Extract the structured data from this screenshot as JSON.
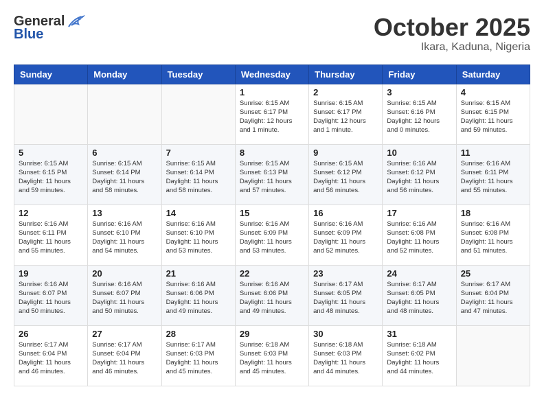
{
  "header": {
    "logo_general": "General",
    "logo_blue": "Blue",
    "month": "October 2025",
    "location": "Ikara, Kaduna, Nigeria"
  },
  "days_of_week": [
    "Sunday",
    "Monday",
    "Tuesday",
    "Wednesday",
    "Thursday",
    "Friday",
    "Saturday"
  ],
  "weeks": [
    [
      {
        "day": "",
        "info": ""
      },
      {
        "day": "",
        "info": ""
      },
      {
        "day": "",
        "info": ""
      },
      {
        "day": "1",
        "info": "Sunrise: 6:15 AM\nSunset: 6:17 PM\nDaylight: 12 hours\nand 1 minute."
      },
      {
        "day": "2",
        "info": "Sunrise: 6:15 AM\nSunset: 6:17 PM\nDaylight: 12 hours\nand 1 minute."
      },
      {
        "day": "3",
        "info": "Sunrise: 6:15 AM\nSunset: 6:16 PM\nDaylight: 12 hours\nand 0 minutes."
      },
      {
        "day": "4",
        "info": "Sunrise: 6:15 AM\nSunset: 6:15 PM\nDaylight: 11 hours\nand 59 minutes."
      }
    ],
    [
      {
        "day": "5",
        "info": "Sunrise: 6:15 AM\nSunset: 6:15 PM\nDaylight: 11 hours\nand 59 minutes."
      },
      {
        "day": "6",
        "info": "Sunrise: 6:15 AM\nSunset: 6:14 PM\nDaylight: 11 hours\nand 58 minutes."
      },
      {
        "day": "7",
        "info": "Sunrise: 6:15 AM\nSunset: 6:14 PM\nDaylight: 11 hours\nand 58 minutes."
      },
      {
        "day": "8",
        "info": "Sunrise: 6:15 AM\nSunset: 6:13 PM\nDaylight: 11 hours\nand 57 minutes."
      },
      {
        "day": "9",
        "info": "Sunrise: 6:15 AM\nSunset: 6:12 PM\nDaylight: 11 hours\nand 56 minutes."
      },
      {
        "day": "10",
        "info": "Sunrise: 6:16 AM\nSunset: 6:12 PM\nDaylight: 11 hours\nand 56 minutes."
      },
      {
        "day": "11",
        "info": "Sunrise: 6:16 AM\nSunset: 6:11 PM\nDaylight: 11 hours\nand 55 minutes."
      }
    ],
    [
      {
        "day": "12",
        "info": "Sunrise: 6:16 AM\nSunset: 6:11 PM\nDaylight: 11 hours\nand 55 minutes."
      },
      {
        "day": "13",
        "info": "Sunrise: 6:16 AM\nSunset: 6:10 PM\nDaylight: 11 hours\nand 54 minutes."
      },
      {
        "day": "14",
        "info": "Sunrise: 6:16 AM\nSunset: 6:10 PM\nDaylight: 11 hours\nand 53 minutes."
      },
      {
        "day": "15",
        "info": "Sunrise: 6:16 AM\nSunset: 6:09 PM\nDaylight: 11 hours\nand 53 minutes."
      },
      {
        "day": "16",
        "info": "Sunrise: 6:16 AM\nSunset: 6:09 PM\nDaylight: 11 hours\nand 52 minutes."
      },
      {
        "day": "17",
        "info": "Sunrise: 6:16 AM\nSunset: 6:08 PM\nDaylight: 11 hours\nand 52 minutes."
      },
      {
        "day": "18",
        "info": "Sunrise: 6:16 AM\nSunset: 6:08 PM\nDaylight: 11 hours\nand 51 minutes."
      }
    ],
    [
      {
        "day": "19",
        "info": "Sunrise: 6:16 AM\nSunset: 6:07 PM\nDaylight: 11 hours\nand 50 minutes."
      },
      {
        "day": "20",
        "info": "Sunrise: 6:16 AM\nSunset: 6:07 PM\nDaylight: 11 hours\nand 50 minutes."
      },
      {
        "day": "21",
        "info": "Sunrise: 6:16 AM\nSunset: 6:06 PM\nDaylight: 11 hours\nand 49 minutes."
      },
      {
        "day": "22",
        "info": "Sunrise: 6:16 AM\nSunset: 6:06 PM\nDaylight: 11 hours\nand 49 minutes."
      },
      {
        "day": "23",
        "info": "Sunrise: 6:17 AM\nSunset: 6:05 PM\nDaylight: 11 hours\nand 48 minutes."
      },
      {
        "day": "24",
        "info": "Sunrise: 6:17 AM\nSunset: 6:05 PM\nDaylight: 11 hours\nand 48 minutes."
      },
      {
        "day": "25",
        "info": "Sunrise: 6:17 AM\nSunset: 6:04 PM\nDaylight: 11 hours\nand 47 minutes."
      }
    ],
    [
      {
        "day": "26",
        "info": "Sunrise: 6:17 AM\nSunset: 6:04 PM\nDaylight: 11 hours\nand 46 minutes."
      },
      {
        "day": "27",
        "info": "Sunrise: 6:17 AM\nSunset: 6:04 PM\nDaylight: 11 hours\nand 46 minutes."
      },
      {
        "day": "28",
        "info": "Sunrise: 6:17 AM\nSunset: 6:03 PM\nDaylight: 11 hours\nand 45 minutes."
      },
      {
        "day": "29",
        "info": "Sunrise: 6:18 AM\nSunset: 6:03 PM\nDaylight: 11 hours\nand 45 minutes."
      },
      {
        "day": "30",
        "info": "Sunrise: 6:18 AM\nSunset: 6:03 PM\nDaylight: 11 hours\nand 44 minutes."
      },
      {
        "day": "31",
        "info": "Sunrise: 6:18 AM\nSunset: 6:02 PM\nDaylight: 11 hours\nand 44 minutes."
      },
      {
        "day": "",
        "info": ""
      }
    ]
  ]
}
